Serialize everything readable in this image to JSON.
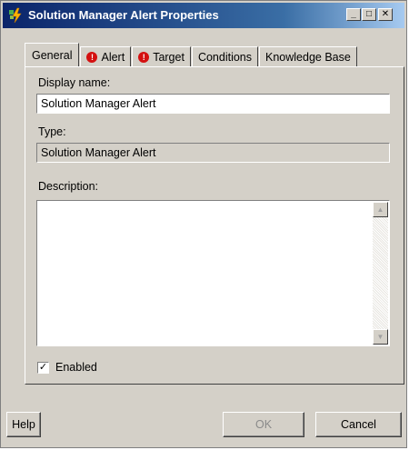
{
  "window": {
    "title": "Solution Manager Alert Properties",
    "controls": {
      "minimize": "_",
      "maximize": "□",
      "close": "✕"
    }
  },
  "tabs": [
    {
      "label": "General",
      "active": true,
      "alert_icon": false
    },
    {
      "label": "Alert",
      "active": false,
      "alert_icon": true
    },
    {
      "label": "Target",
      "active": false,
      "alert_icon": true
    },
    {
      "label": "Conditions",
      "active": false,
      "alert_icon": false
    },
    {
      "label": "Knowledge Base",
      "active": false,
      "alert_icon": false
    }
  ],
  "general": {
    "display_name_label": "Display name:",
    "display_name_value": "Solution Manager Alert",
    "type_label": "Type:",
    "type_value": "Solution Manager Alert",
    "description_label": "Description:",
    "description_value": "",
    "enabled_label": "Enabled",
    "enabled_checked": true,
    "check_glyph": "✓"
  },
  "buttons": {
    "help": "Help",
    "ok": "OK",
    "cancel": "Cancel"
  },
  "colors": {
    "window_bg": "#d4d0c8",
    "titlebar_start": "#0a246a",
    "titlebar_end": "#a6caf0",
    "alert_icon": "#d41010",
    "disabled_text": "#8a8a8a"
  },
  "icons": {
    "alert_tab_icon": "exclamation-circle-icon",
    "title_icon": "lightning-app-icon"
  }
}
